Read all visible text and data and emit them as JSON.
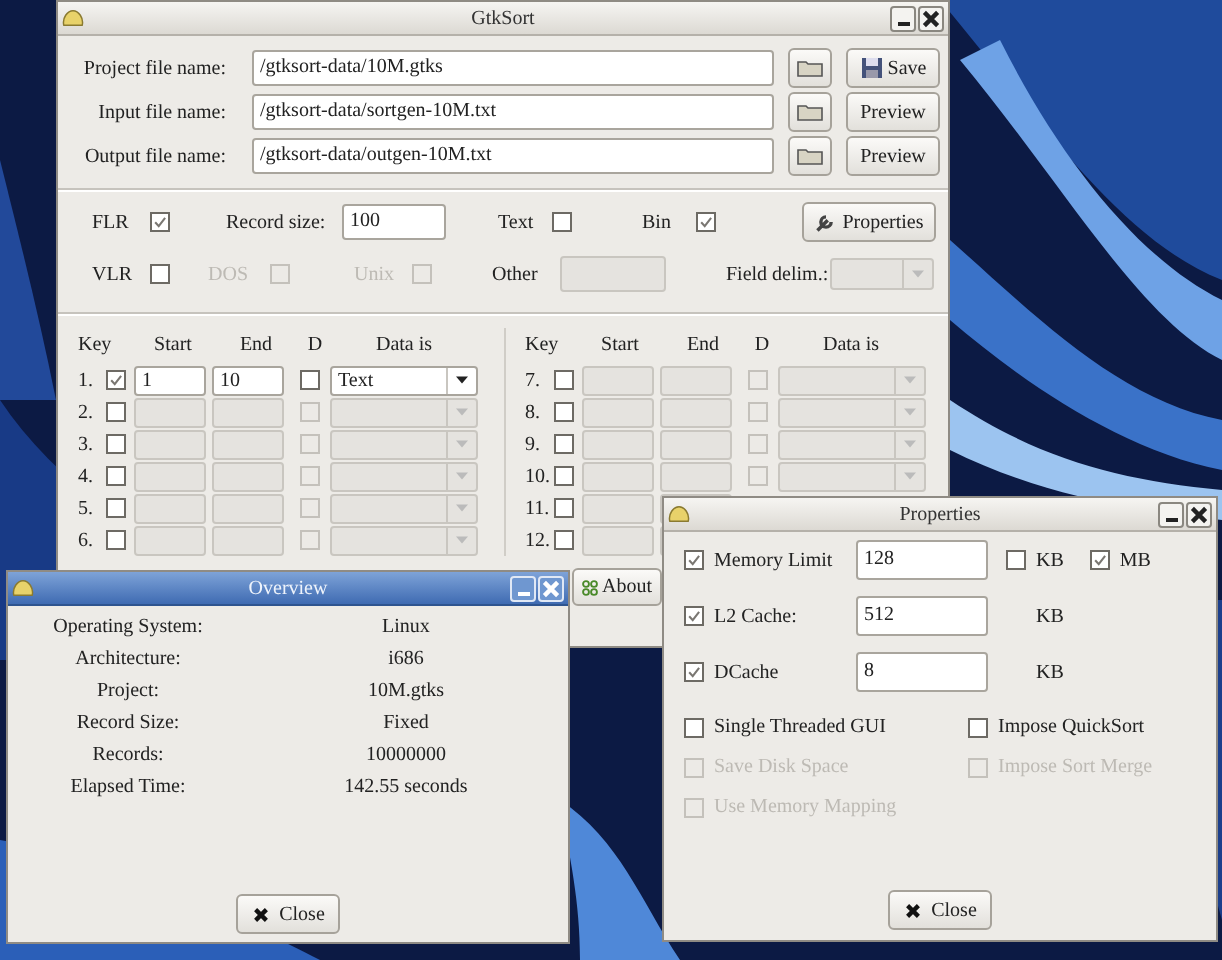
{
  "gtksort": {
    "title": "GtkSort",
    "active": false,
    "files": [
      {
        "label": "Project file name:",
        "value": "/gtksort-data/10M.gtks",
        "action": {
          "kind": "save",
          "label": "Save"
        }
      },
      {
        "label": "Input file name:",
        "value": "/gtksort-data/sortgen-10M.txt",
        "action": {
          "kind": "plain",
          "label": "Preview"
        }
      },
      {
        "label": "Output file name:",
        "value": "/gtksort-data/outgen-10M.txt",
        "action": {
          "kind": "plain",
          "label": "Preview"
        }
      }
    ],
    "record_options": [
      {
        "kind": "check",
        "label": "FLR",
        "checked": true,
        "disabled": false
      },
      {
        "kind": "field",
        "label": "Record size:",
        "value": "100",
        "disabled": false
      },
      {
        "kind": "check",
        "label": "Text",
        "checked": false,
        "disabled": false
      },
      {
        "kind": "check",
        "label": "Bin",
        "checked": true,
        "disabled": false
      },
      {
        "kind": "button",
        "label": "Properties"
      }
    ],
    "line_options": [
      {
        "kind": "check",
        "label": "VLR",
        "checked": false,
        "disabled": false
      },
      {
        "kind": "check",
        "label": "DOS",
        "checked": false,
        "disabled": true
      },
      {
        "kind": "check",
        "label": "Unix",
        "checked": false,
        "disabled": true
      },
      {
        "kind": "field",
        "label": "Other",
        "disabled": true
      },
      {
        "kind": "combo",
        "label": "Field delim.:",
        "disabled": true
      }
    ],
    "key_halves": [
      {
        "columns": [
          "Key",
          "Start",
          "End",
          "D",
          "Data is"
        ],
        "rows": [
          {
            "number": "1.",
            "checked": true,
            "start": "1",
            "end": "10",
            "descending": false,
            "data_is": "Text",
            "disabled": false
          },
          {
            "number": "2.",
            "checked": false,
            "descending": false,
            "disabled": true
          },
          {
            "number": "3.",
            "checked": false,
            "descending": false,
            "disabled": true
          },
          {
            "number": "4.",
            "checked": false,
            "descending": false,
            "disabled": true
          },
          {
            "number": "5.",
            "checked": false,
            "descending": false,
            "disabled": true
          },
          {
            "number": "6.",
            "checked": false,
            "descending": false,
            "disabled": true
          }
        ]
      },
      {
        "columns": [
          "Key",
          "Start",
          "End",
          "D",
          "Data is"
        ],
        "rows": [
          {
            "number": "7.",
            "checked": false,
            "descending": false,
            "disabled": true
          },
          {
            "number": "8.",
            "checked": false,
            "descending": false,
            "disabled": true
          },
          {
            "number": "9.",
            "checked": false,
            "descending": false,
            "disabled": true
          },
          {
            "number": "10.",
            "checked": false,
            "descending": false,
            "disabled": true
          },
          {
            "number": "11.",
            "checked": false,
            "disabled": true
          },
          {
            "number": "12.",
            "checked": false,
            "disabled": true
          }
        ]
      }
    ],
    "about": "About"
  },
  "overview": {
    "title": "Overview",
    "active": true,
    "rows": [
      {
        "label": "Operating System:",
        "value": "Linux"
      },
      {
        "label": "Architecture:",
        "value": "i686"
      },
      {
        "label": "Project:",
        "value": "10M.gtks"
      },
      {
        "label": "Record Size:",
        "value": "Fixed"
      },
      {
        "label": "Records:",
        "value": "10000000"
      },
      {
        "label": "Elapsed Time:",
        "value": "142.55 seconds"
      }
    ],
    "close": "Close"
  },
  "properties": {
    "title": "Properties",
    "active": false,
    "limits": [
      {
        "label": "Memory Limit",
        "checked": true,
        "value": "128",
        "units": [
          {
            "label": "KB",
            "checked": false
          },
          {
            "label": "MB",
            "checked": true
          }
        ]
      },
      {
        "label": "L2 Cache:",
        "checked": true,
        "value": "512",
        "unit": "KB"
      },
      {
        "label": "DCache",
        "checked": true,
        "value": "8",
        "unit": "KB"
      }
    ],
    "options": [
      {
        "label": "Single Threaded GUI",
        "checked": false,
        "disabled": false
      },
      {
        "label": "Impose QuickSort",
        "checked": false,
        "disabled": false
      },
      {
        "label": "Save Disk Space",
        "checked": false,
        "disabled": true
      },
      {
        "label": "Impose Sort Merge",
        "checked": false,
        "disabled": true
      },
      {
        "label": "Use Memory Mapping",
        "checked": false,
        "disabled": true
      }
    ],
    "close": "Close"
  }
}
